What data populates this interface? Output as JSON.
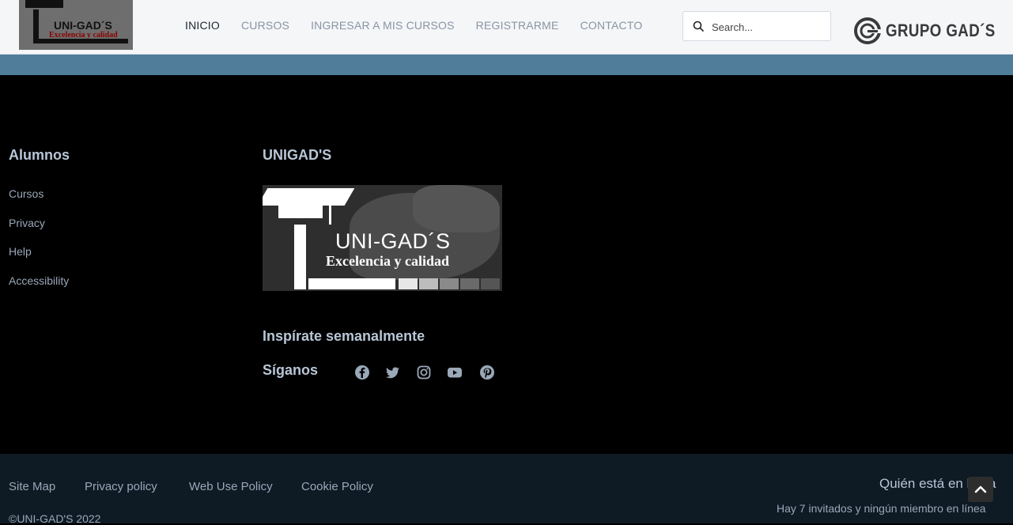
{
  "header": {
    "logo": {
      "name": "UNI-GAD´S",
      "tagline": "Excelencia y calidad"
    },
    "nav": [
      {
        "label": "INICIO",
        "active": true
      },
      {
        "label": "CURSOS",
        "active": false
      },
      {
        "label": "INGRESAR A MIS CURSOS",
        "active": false
      },
      {
        "label": "REGISTRARME",
        "active": false
      },
      {
        "label": "CONTACTO",
        "active": false
      }
    ],
    "search": {
      "placeholder": "Search...",
      "icon": "search-icon"
    },
    "brand": {
      "text": "GRUPO GAD´S"
    }
  },
  "footer": {
    "alumnos": {
      "title": "Alumnos",
      "links": [
        "Cursos",
        "Privacy",
        "Help",
        "Accessibility"
      ]
    },
    "unigads": {
      "title": "UNIGAD'S",
      "logo": {
        "name": "UNI-GAD´S",
        "tagline": "Excelencia y calidad"
      },
      "inspire": "Inspírate semanalmente",
      "follow": "Síganos",
      "social": [
        "facebook-icon",
        "twitter-icon",
        "instagram-icon",
        "youtube-icon",
        "pinterest-icon"
      ]
    }
  },
  "bottom": {
    "links": [
      "Site Map",
      "Privacy policy",
      "Web Use Policy",
      "Cookie Policy"
    ],
    "copyright": "©UNI-GAD'S 2022",
    "who_title": "Quién está en línea",
    "who_text": "Hay 7 invitados y ningún miembro en línea"
  },
  "colors": {
    "accent_band": "#4f7d9a",
    "footer_bg": "#000000",
    "bottom_bg": "#0e1a24"
  }
}
